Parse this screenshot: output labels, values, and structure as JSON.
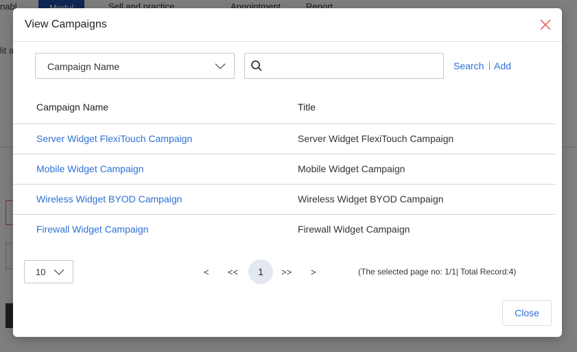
{
  "background": {
    "tabs": [
      "nabl",
      "Modul",
      "Sell and practice",
      "Appointment",
      "Report"
    ],
    "side_text": "lit a"
  },
  "modal": {
    "title": "View Campaigns",
    "filter": {
      "selected": "Campaign Name"
    },
    "search": {
      "value": "",
      "placeholder": ""
    },
    "search_link": "Search",
    "add_link": "Add",
    "table": {
      "headers": [
        "Campaign Name",
        "Title"
      ],
      "rows": [
        {
          "name": "Server Widget FlexiTouch Campaign",
          "title": "Server Widget FlexiTouch Campaign"
        },
        {
          "name": "Mobile Widget Campaign",
          "title": "Mobile Widget Campaign"
        },
        {
          "name": "Wireless Widget BYOD Campaign",
          "title": "Wireless Widget BYOD Campaign"
        },
        {
          "name": "Firewall Widget Campaign",
          "title": "Firewall Widget Campaign"
        }
      ]
    },
    "pagination": {
      "page_size": "10",
      "prev": "<",
      "first": "<<",
      "current": "1",
      "last": ">>",
      "next": ">",
      "info": "(The selected page no: 1/1| Total Record:4)"
    },
    "close_label": "Close"
  },
  "colors": {
    "link": "#2f6fd6",
    "close_icon": "#e26b6b",
    "active_tab": "#1e4fa8"
  },
  "icons": {
    "close": "close-icon",
    "chevron": "chevron-down-icon",
    "search": "search-icon"
  }
}
